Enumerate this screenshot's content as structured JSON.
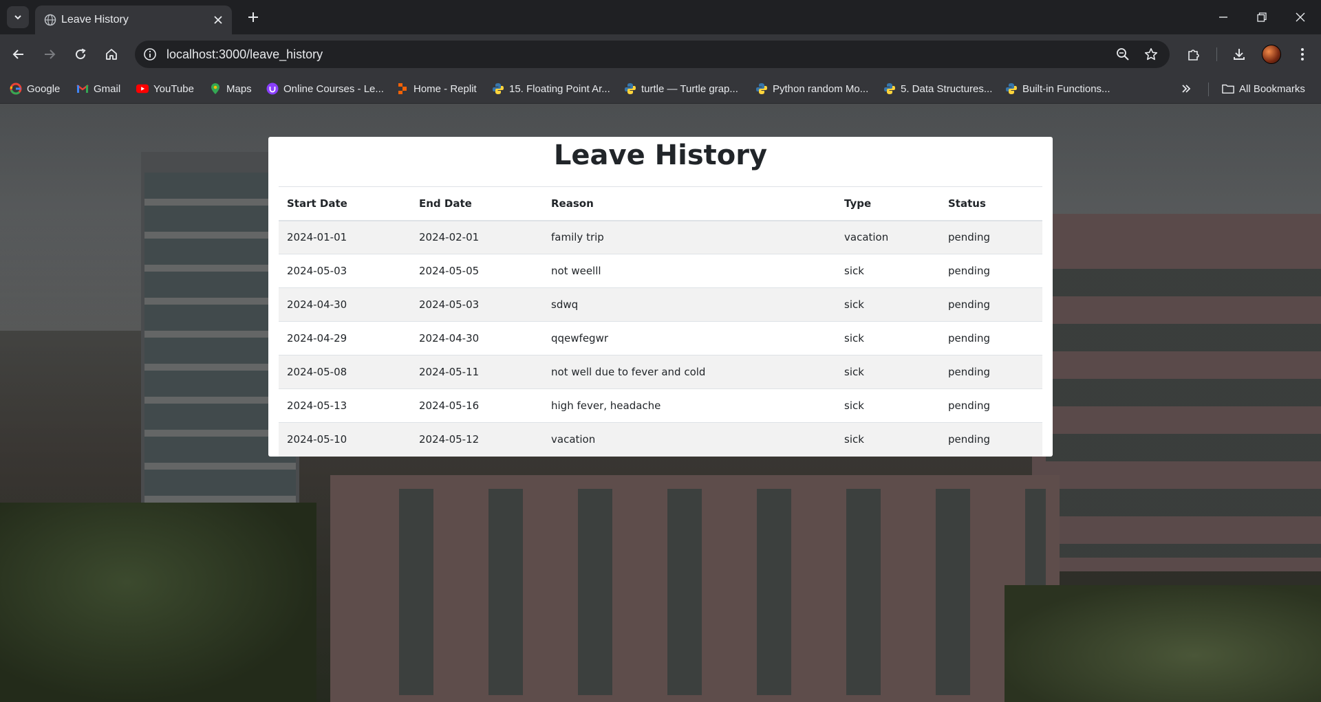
{
  "browser": {
    "tab": {
      "title": "Leave History"
    },
    "address": {
      "url": "localhost:3000/leave_history"
    },
    "bookmarks": [
      {
        "label": "Google",
        "icon": "google-icon"
      },
      {
        "label": "Gmail",
        "icon": "gmail-icon"
      },
      {
        "label": "YouTube",
        "icon": "youtube-icon"
      },
      {
        "label": "Maps",
        "icon": "maps-icon"
      },
      {
        "label": "Online Courses - Le...",
        "icon": "udemy-icon"
      },
      {
        "label": "Home - Replit",
        "icon": "replit-icon"
      },
      {
        "label": "15. Floating Point Ar...",
        "icon": "python-icon"
      },
      {
        "label": "turtle — Turtle grap...",
        "icon": "python-icon"
      },
      {
        "label": "Python random Mo...",
        "icon": "python-icon"
      },
      {
        "label": "5. Data Structures...",
        "icon": "python-icon"
      },
      {
        "label": "Built-in Functions...",
        "icon": "python-icon"
      }
    ],
    "all_bookmarks_label": "All Bookmarks"
  },
  "page": {
    "title": "Leave History",
    "table": {
      "headers": [
        "Start Date",
        "End Date",
        "Reason",
        "Type",
        "Status"
      ],
      "rows": [
        [
          "2024-01-01",
          "2024-02-01",
          "family trip",
          "vacation",
          "pending"
        ],
        [
          "2024-05-03",
          "2024-05-05",
          "not weelll",
          "sick",
          "pending"
        ],
        [
          "2024-04-30",
          "2024-05-03",
          "sdwq",
          "sick",
          "pending"
        ],
        [
          "2024-04-29",
          "2024-04-30",
          "qqewfegwr",
          "sick",
          "pending"
        ],
        [
          "2024-05-08",
          "2024-05-11",
          "not well due to fever and cold",
          "sick",
          "pending"
        ],
        [
          "2024-05-13",
          "2024-05-16",
          "high fever, headache",
          "sick",
          "pending"
        ],
        [
          "2024-05-10",
          "2024-05-12",
          "vacation",
          "sick",
          "pending"
        ]
      ]
    }
  },
  "colors": {
    "chrome_dark": "#1f2023",
    "chrome_toolbar": "#35363a",
    "omnibox": "#202124",
    "text_light": "#e8eaed",
    "card_bg": "#ffffff",
    "stripe_row": "#f2f2f2",
    "table_text": "#212529"
  }
}
